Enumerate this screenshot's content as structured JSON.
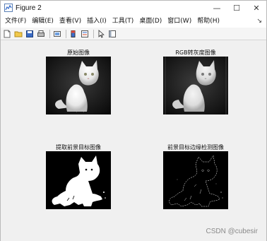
{
  "window": {
    "title": "Figure 2",
    "controls": {
      "minimize": "—",
      "maximize": "☐",
      "close": "✕"
    }
  },
  "menubar": {
    "items": [
      {
        "label": "文件(F)"
      },
      {
        "label": "编辑(E)"
      },
      {
        "label": "查看(V)"
      },
      {
        "label": "插入(I)"
      },
      {
        "label": "工具(T)"
      },
      {
        "label": "桌面(D)"
      },
      {
        "label": "窗口(W)"
      },
      {
        "label": "帮助(H)"
      }
    ],
    "overflow_arrow": "↘"
  },
  "toolbar": {
    "icons": [
      "new-figure-icon",
      "open-icon",
      "save-icon",
      "print-icon",
      "copy-figure-icon",
      "colorbar-icon",
      "legend-icon",
      "edit-plot-icon",
      "property-inspector-icon"
    ]
  },
  "panels": {
    "p1": {
      "title": "原始图像"
    },
    "p2": {
      "title": "RGB转灰度图像"
    },
    "p3": {
      "title": "提取前景目标图像"
    },
    "p4": {
      "title": "前景目标边缘检测图像"
    }
  },
  "watermark": "CSDN @cubesir"
}
